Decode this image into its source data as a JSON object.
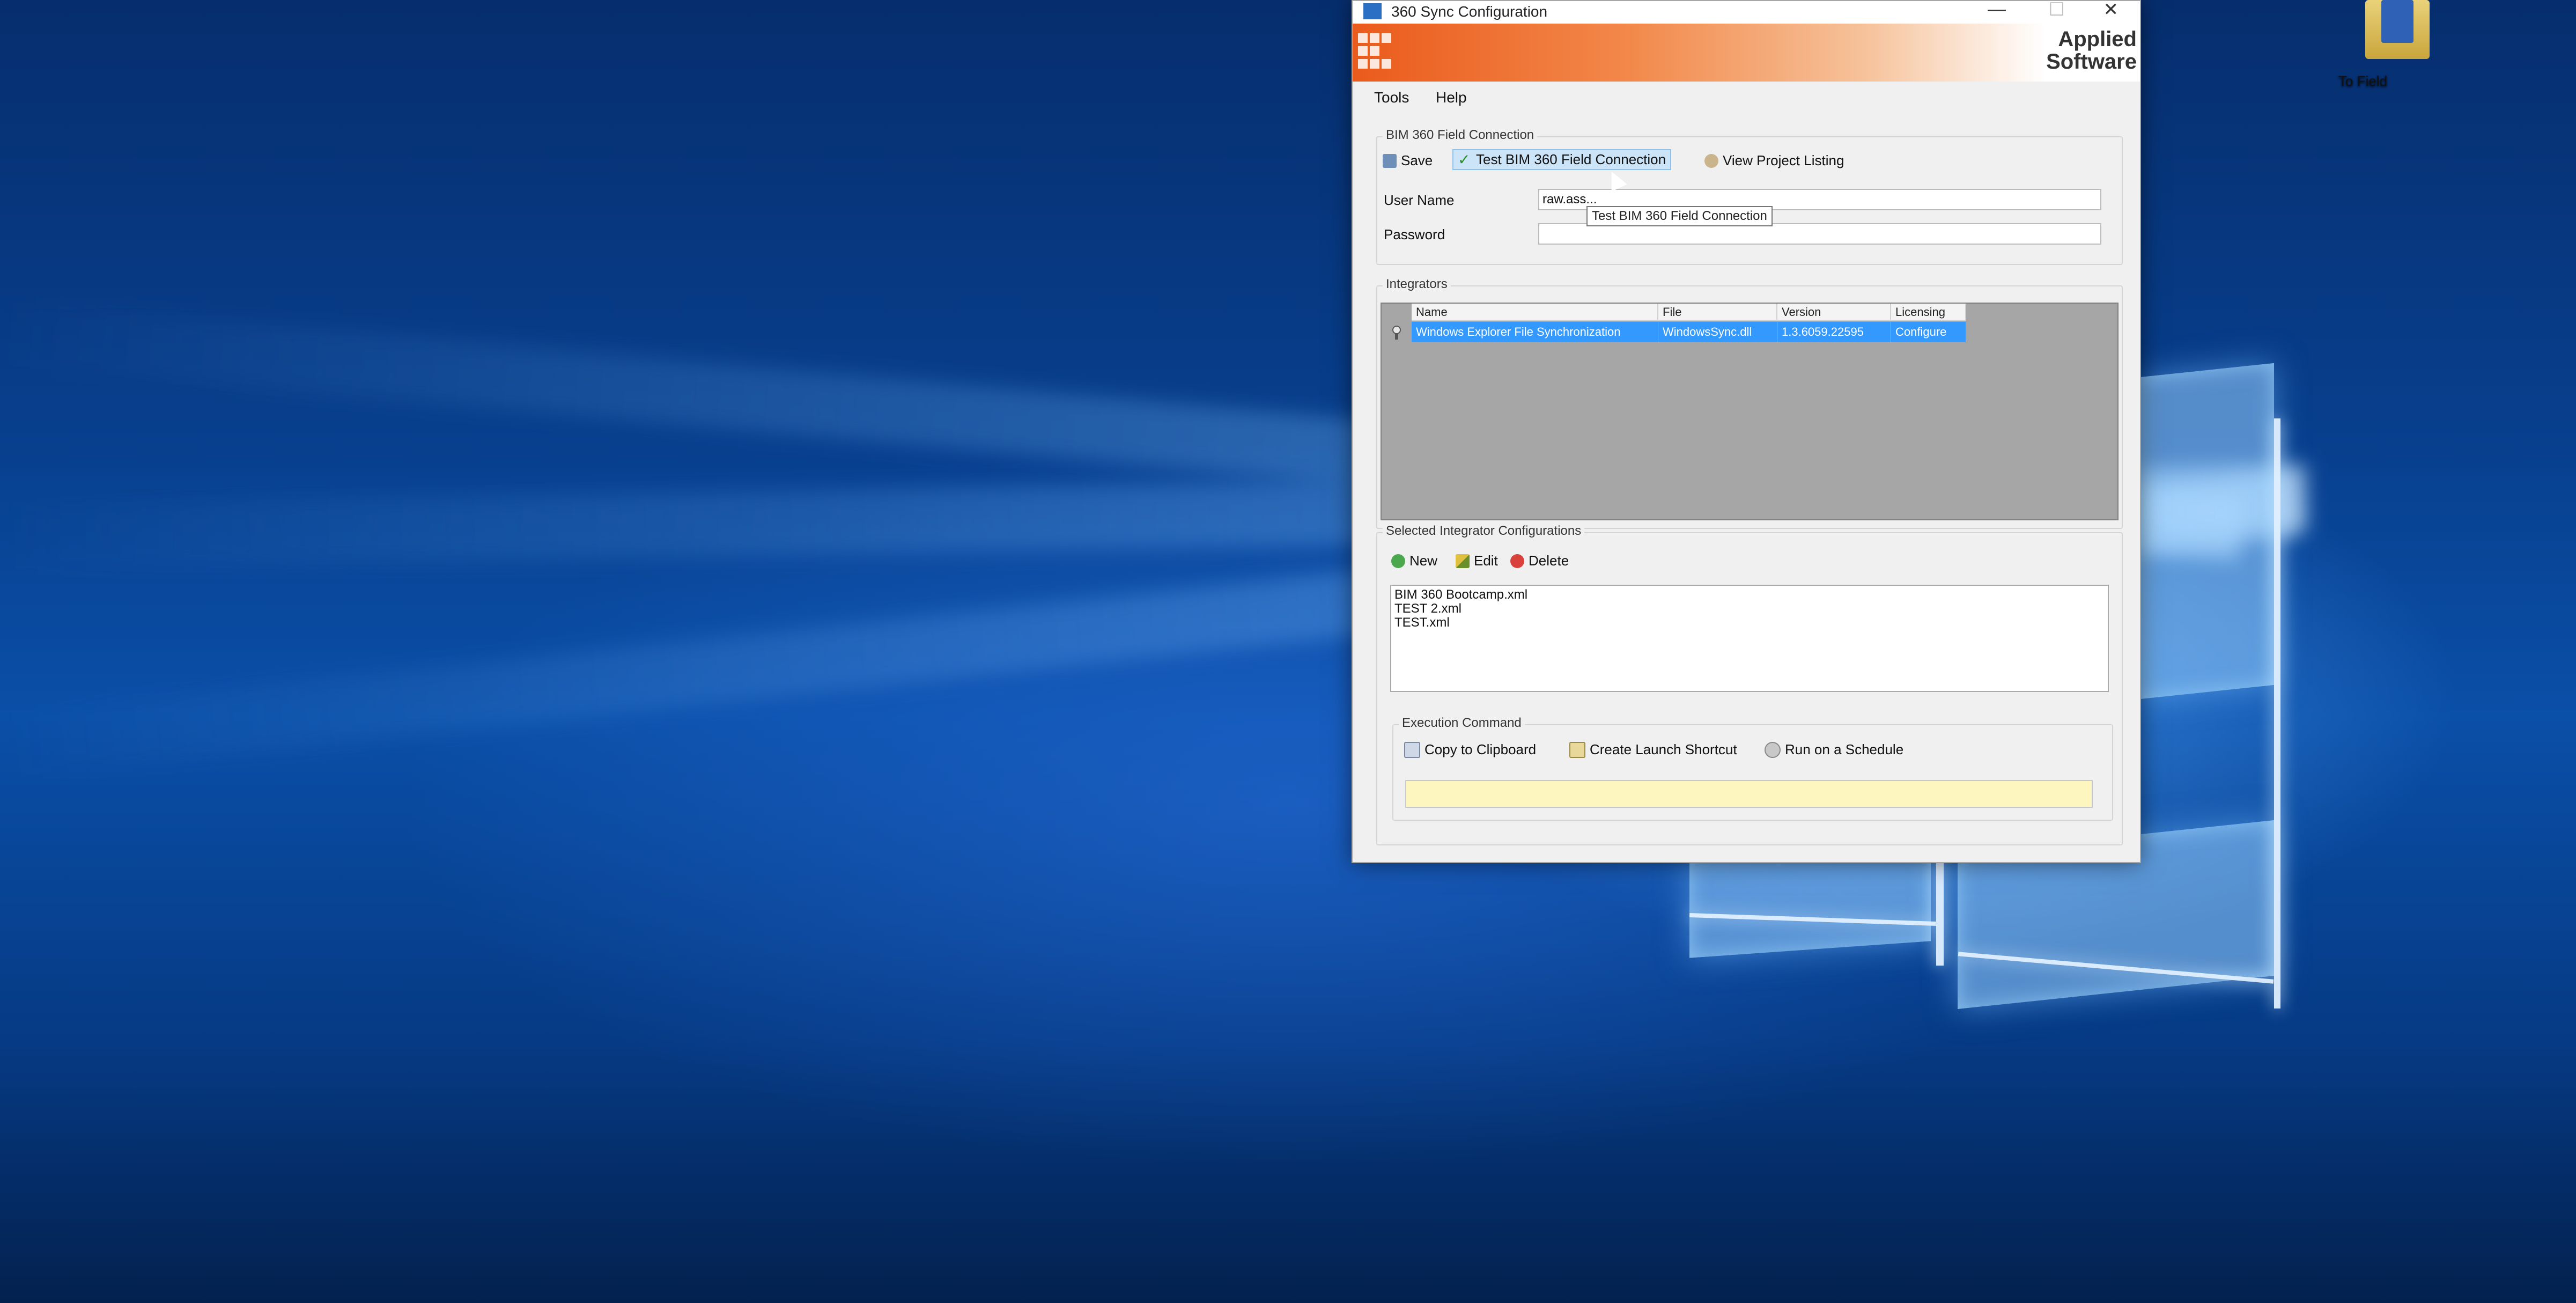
{
  "desktop": {
    "icons": [
      {
        "label": "To Field",
        "icon": "folder-app-icon"
      }
    ]
  },
  "window": {
    "title": "360 Sync Configuration",
    "controls": {
      "minimize": "—",
      "maximize": "☐",
      "close": "✕"
    },
    "brand": {
      "line1": "Applied",
      "line2": "Software"
    },
    "menu": [
      "Tools",
      "Help"
    ],
    "connection": {
      "legend": "BIM 360 Field Connection",
      "toolbar": {
        "save": "Save",
        "test": "Test BIM 360 Field Connection",
        "view": "View Project Listing"
      },
      "username_label": "User Name",
      "username_value": "raw.ass...",
      "password_label": "Password",
      "password_value": "",
      "tooltip": "Test BIM 360 Field Connection"
    },
    "integrators": {
      "legend": "Integrators",
      "columns": [
        "Name",
        "File",
        "Version",
        "Licensing"
      ],
      "rows": [
        [
          "Windows Explorer File Synchronization",
          "WindowsSync.dll",
          "1.3.6059.22595",
          "Configure"
        ]
      ]
    },
    "selected_configs": {
      "legend": "Selected Integrator Configurations",
      "toolbar": {
        "new": "New",
        "edit": "Edit",
        "delete": "Delete"
      },
      "items": [
        "BIM 360 Bootcamp.xml",
        "TEST 2.xml",
        "TEST.xml"
      ]
    },
    "execution": {
      "legend": "Execution Command",
      "toolbar": {
        "copy": "Copy to Clipboard",
        "shortcut": "Create Launch Shortcut",
        "schedule": "Run on a Schedule"
      },
      "command_value": ""
    }
  },
  "colors": {
    "banner_orange": "#ea5b1c",
    "selection_blue": "#3399ff",
    "command_field": "#fef6bf"
  }
}
